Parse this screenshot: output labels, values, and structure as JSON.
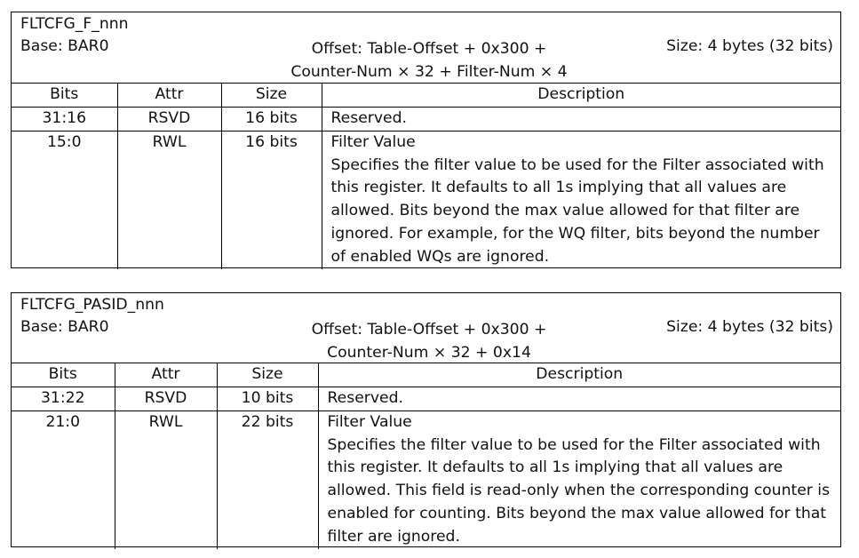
{
  "registers": [
    {
      "name": "FLTCFG_F_nnn",
      "base": "Base: BAR0",
      "offset_line1": "Offset: Table-Offset + 0x300 +",
      "offset_line2": "Counter-Num × 32 + Filter-Num × 4",
      "size": "Size: 4 bytes (32 bits)",
      "columns": [
        "Bits",
        "Attr",
        "Size",
        "Description"
      ],
      "rows": [
        {
          "bits": "31:16",
          "attr": "RSVD",
          "size": "16 bits",
          "title": "",
          "desc": "Reserved."
        },
        {
          "bits": "15:0",
          "attr": "RWL",
          "size": "16 bits",
          "title": "Filter Value",
          "desc": "Specifies the filter value to be used for the Filter associated with this register. It defaults to all 1s implying that all values are allowed. Bits beyond the max value allowed for that filter are ignored. For example, for the WQ filter, bits beyond the number of enabled WQs are ignored."
        }
      ]
    },
    {
      "name": "FLTCFG_PASID_nnn",
      "base": "Base: BAR0",
      "offset_line1": "Offset: Table-Offset + 0x300 +",
      "offset_line2": "Counter-Num × 32 + 0x14",
      "size": "Size: 4 bytes (32 bits)",
      "columns": [
        "Bits",
        "Attr",
        "Size",
        "Description"
      ],
      "rows": [
        {
          "bits": "31:22",
          "attr": "RSVD",
          "size": "10 bits",
          "title": "",
          "desc": "Reserved."
        },
        {
          "bits": "21:0",
          "attr": "RWL",
          "size": "22 bits",
          "title": "Filter Value",
          "desc": "Specifies the filter value to be used for the Filter associated with this register. It defaults to all 1s implying that all values are allowed. This field is read-only when the corresponding counter is enabled for counting. Bits beyond the max value allowed for that filter are ignored."
        }
      ]
    }
  ]
}
